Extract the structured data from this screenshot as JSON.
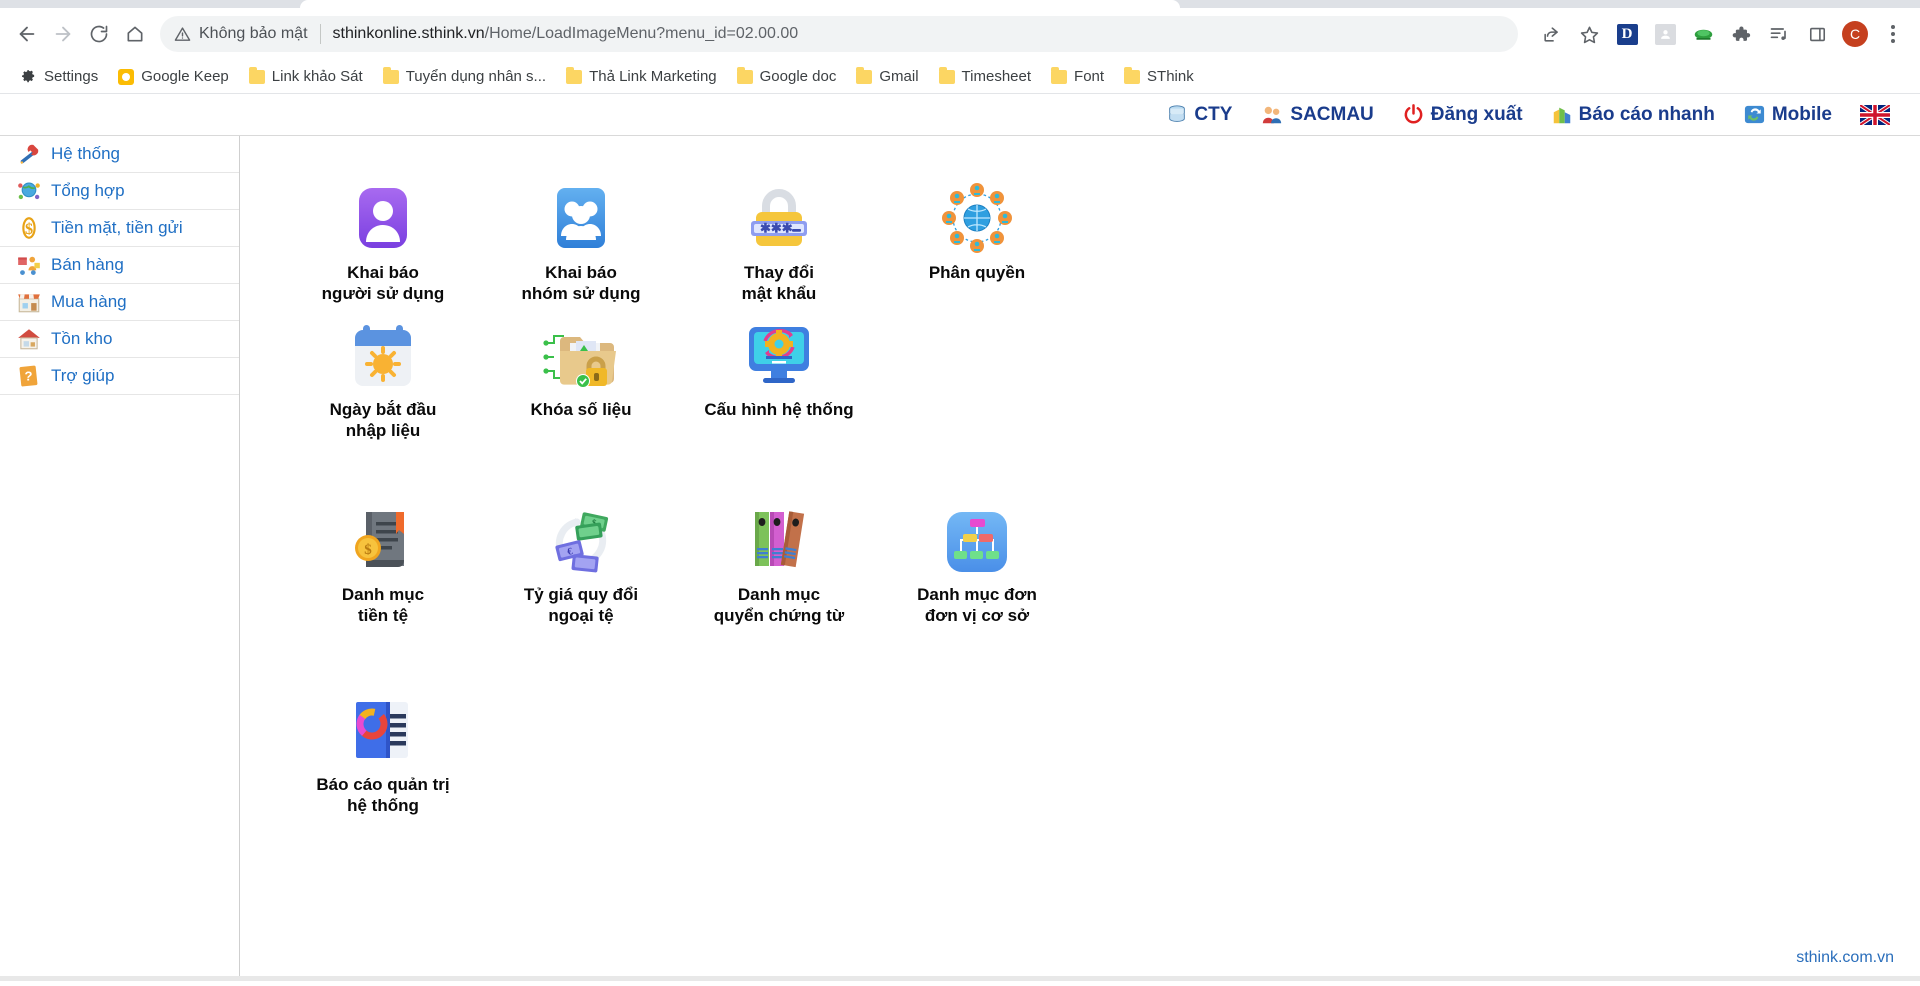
{
  "browser": {
    "nav": {
      "back": "back-arrow",
      "forward": "forward-arrow",
      "reload": "reload",
      "home": "home"
    },
    "omnibox": {
      "security_label": "Không bảo mật",
      "url_host": "sthinkonline.sthink.vn",
      "url_path": "/Home/LoadImageMenu?menu_id=02.00.00"
    },
    "toolbar_icons": [
      "share-icon",
      "bookmark-star-icon",
      "extension-d-icon",
      "extension-gray-icon",
      "extension-green-icon",
      "extensions-puzzle-icon",
      "reading-list-icon",
      "side-panel-icon"
    ],
    "profile_initial": "C",
    "menu": "three-dot-menu"
  },
  "bookmarks": [
    {
      "label": "Settings",
      "icon": "gear-icon"
    },
    {
      "label": "Google Keep",
      "icon": "keep-icon"
    },
    {
      "label": "Link khảo Sát",
      "icon": "folder-icon"
    },
    {
      "label": "Tuyển dụng nhân s...",
      "icon": "folder-icon"
    },
    {
      "label": "Thả Link Marketing",
      "icon": "folder-icon"
    },
    {
      "label": "Google doc",
      "icon": "folder-icon"
    },
    {
      "label": "Gmail",
      "icon": "folder-icon"
    },
    {
      "label": "Timesheet",
      "icon": "folder-icon"
    },
    {
      "label": "Font",
      "icon": "folder-icon"
    },
    {
      "label": "SThink",
      "icon": "folder-icon"
    }
  ],
  "topnav": [
    {
      "label": "CTY",
      "icon": "database-icon"
    },
    {
      "label": "SACMAU",
      "icon": "users-icon"
    },
    {
      "label": "Đăng xuất",
      "icon": "power-icon"
    },
    {
      "label": "Báo cáo nhanh",
      "icon": "chart-icon"
    },
    {
      "label": "Mobile",
      "icon": "sync-icon"
    },
    {
      "label": "",
      "icon": "uk-flag-icon"
    }
  ],
  "sidebar": {
    "items": [
      {
        "label": "Hệ thống",
        "icon": "tools-icon"
      },
      {
        "label": "Tổng hợp",
        "icon": "globe-people-icon"
      },
      {
        "label": "Tiền mặt, tiền gửi",
        "icon": "dollar-icon"
      },
      {
        "label": "Bán hàng",
        "icon": "shop-delivery-icon"
      },
      {
        "label": "Mua hàng",
        "icon": "store-icon"
      },
      {
        "label": "Tồn kho",
        "icon": "warehouse-icon"
      },
      {
        "label": "Trợ giúp",
        "icon": "help-book-icon"
      }
    ]
  },
  "main": {
    "rows": [
      [
        {
          "label_line1": "Khai báo",
          "label_line2": "người sử dụng",
          "icon": "user-badge-icon"
        },
        {
          "label_line1": "Khai báo",
          "label_line2": "nhóm sử dụng",
          "icon": "user-group-icon"
        },
        {
          "label_line1": "Thay đổi",
          "label_line2": "mật khẩu",
          "icon": "password-lock-icon"
        },
        {
          "label_line1": "Phân quyền",
          "label_line2": "",
          "icon": "permissions-network-icon"
        }
      ],
      [
        {
          "label_line1": "Ngày bắt đầu",
          "label_line2": "nhập liệu",
          "icon": "calendar-sun-icon"
        },
        {
          "label_line1": "Khóa số liệu",
          "label_line2": "",
          "icon": "locked-folder-icon"
        },
        {
          "label_line1": "Cấu hình hệ thống",
          "label_line2": "",
          "icon": "monitor-gear-icon"
        }
      ],
      [
        {
          "label_line1": "Danh mục",
          "label_line2": "tiền tệ",
          "icon": "currency-list-icon"
        },
        {
          "label_line1": "Tỷ giá quy đổi",
          "label_line2": "ngoại tệ",
          "icon": "exchange-rate-icon"
        },
        {
          "label_line1": "Danh mục",
          "label_line2": "quyển chứng từ",
          "icon": "binders-icon"
        },
        {
          "label_line1": "Danh mục đơn",
          "label_line2": "đơn vị cơ sở",
          "icon": "org-chart-icon"
        }
      ],
      [
        {
          "label_line1": "Báo cáo quản trị",
          "label_line2": "hệ thống",
          "icon": "report-book-icon"
        }
      ]
    ]
  },
  "footer": {
    "brand": "sthink.com.vn"
  },
  "colors": {
    "link_blue": "#1f6fc4",
    "topnav_blue": "#1a3c8c",
    "omnibox_bg": "#f1f3f4",
    "tabstrip_bg": "#dee1e6",
    "profile_red": "#c5401f",
    "folder_yellow": "#fcd663"
  }
}
